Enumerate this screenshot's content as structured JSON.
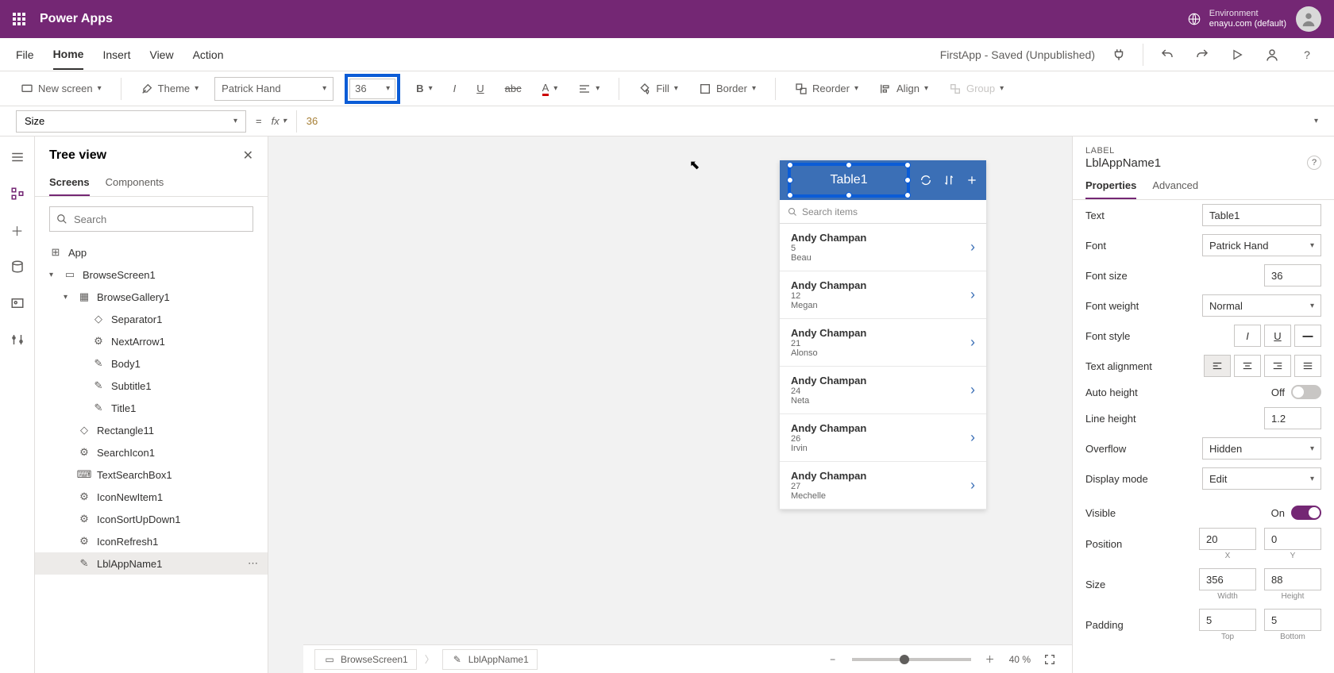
{
  "header": {
    "app": "Power Apps",
    "env_label": "Environment",
    "env_name": "enayu.com (default)"
  },
  "menubar": {
    "items": [
      "File",
      "Home",
      "Insert",
      "View",
      "Action"
    ],
    "active": "Home",
    "status": "FirstApp - Saved (Unpublished)"
  },
  "toolbar": {
    "newscreen": "New screen",
    "theme": "Theme",
    "font": "Patrick Hand",
    "fontsize": "36",
    "fill": "Fill",
    "border": "Border",
    "reorder": "Reorder",
    "align": "Align",
    "group": "Group"
  },
  "formulabar": {
    "property": "Size",
    "value": "36"
  },
  "treeview": {
    "title": "Tree view",
    "tabs": [
      "Screens",
      "Components"
    ],
    "active_tab": "Screens",
    "search_placeholder": "Search",
    "app": "App",
    "items": [
      {
        "level": 1,
        "name": "BrowseScreen1",
        "expand": "v"
      },
      {
        "level": 2,
        "name": "BrowseGallery1",
        "expand": "v"
      },
      {
        "level": 3,
        "name": "Separator1"
      },
      {
        "level": 3,
        "name": "NextArrow1"
      },
      {
        "level": 3,
        "name": "Body1"
      },
      {
        "level": 3,
        "name": "Subtitle1"
      },
      {
        "level": 3,
        "name": "Title1"
      },
      {
        "level": 2,
        "name": "Rectangle11"
      },
      {
        "level": 2,
        "name": "SearchIcon1"
      },
      {
        "level": 2,
        "name": "TextSearchBox1"
      },
      {
        "level": 2,
        "name": "IconNewItem1"
      },
      {
        "level": 2,
        "name": "IconSortUpDown1"
      },
      {
        "level": 2,
        "name": "IconRefresh1"
      },
      {
        "level": 2,
        "name": "LblAppName1",
        "selected": true
      }
    ]
  },
  "canvas": {
    "title": "Table1",
    "search_placeholder": "Search items",
    "gallery": [
      {
        "title": "Andy Champan",
        "sub": "5",
        "body": "Beau"
      },
      {
        "title": "Andy Champan",
        "sub": "12",
        "body": "Megan"
      },
      {
        "title": "Andy Champan",
        "sub": "21",
        "body": "Alonso"
      },
      {
        "title": "Andy Champan",
        "sub": "24",
        "body": "Neta"
      },
      {
        "title": "Andy Champan",
        "sub": "26",
        "body": "Irvin"
      },
      {
        "title": "Andy Champan",
        "sub": "27",
        "body": "Mechelle"
      }
    ]
  },
  "statusbar": {
    "crumb1": "BrowseScreen1",
    "crumb2": "LblAppName1",
    "zoom": "40",
    "zoom_suffix": " %"
  },
  "props": {
    "type": "LABEL",
    "name": "LblAppName1",
    "tabs": [
      "Properties",
      "Advanced"
    ],
    "active_tab": "Properties",
    "rows": {
      "text_label": "Text",
      "text_value": "Table1",
      "font_label": "Font",
      "font_value": "Patrick Hand",
      "fontsize_label": "Font size",
      "fontsize_value": "36",
      "fontweight_label": "Font weight",
      "fontweight_value": "Normal",
      "fontstyle_label": "Font style",
      "align_label": "Text alignment",
      "autoheight_label": "Auto height",
      "autoheight_state": "Off",
      "lineheight_label": "Line height",
      "lineheight_value": "1.2",
      "overflow_label": "Overflow",
      "overflow_value": "Hidden",
      "displaymode_label": "Display mode",
      "displaymode_value": "Edit",
      "visible_label": "Visible",
      "visible_state": "On",
      "position_label": "Position",
      "pos_x": "20",
      "pos_y": "0",
      "x_label": "X",
      "y_label": "Y",
      "size_label": "Size",
      "size_w": "356",
      "size_h": "88",
      "w_label": "Width",
      "h_label": "Height",
      "padding_label": "Padding",
      "pad_top": "5",
      "pad_bottom": "5",
      "top_label": "Top",
      "bottom_label": "Bottom"
    }
  }
}
